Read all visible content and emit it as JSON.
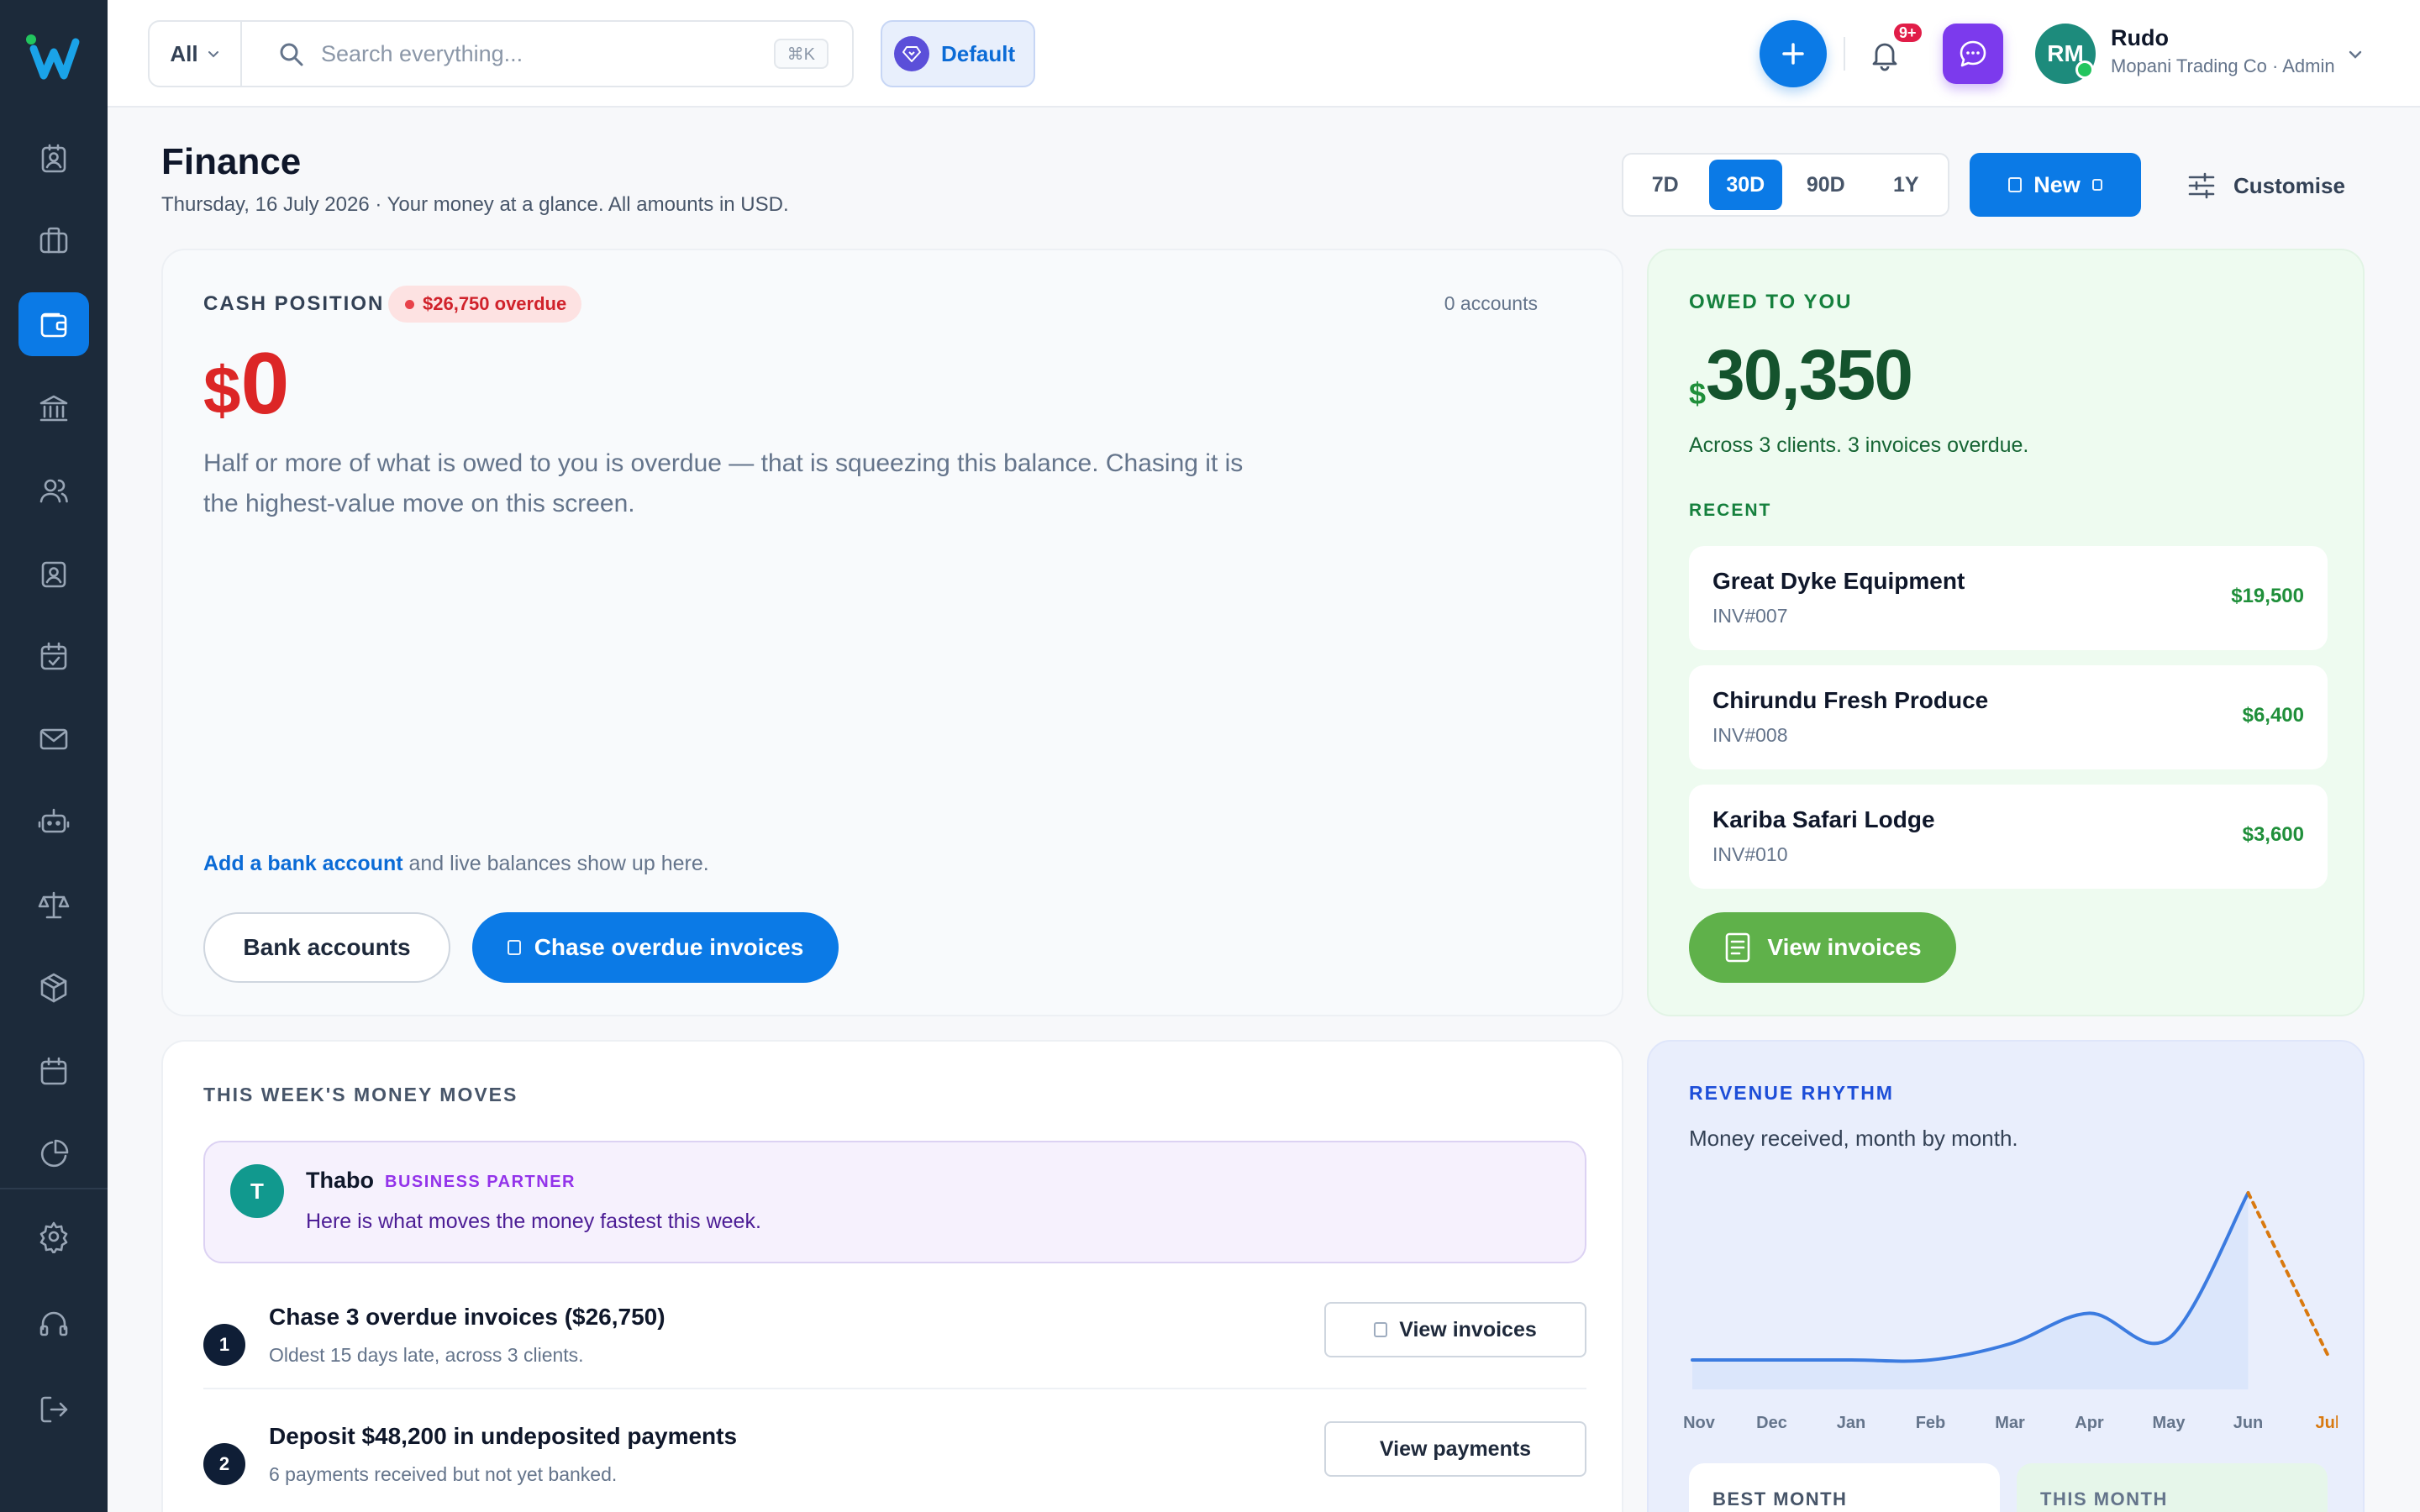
{
  "topbar": {
    "search_scope": "All",
    "search_placeholder": "Search everything...",
    "search_shortcut": "⌘K",
    "workspace": "Default",
    "notification_badge": "9+",
    "user": {
      "initials": "RM",
      "name": "Rudo",
      "org": "Mopani Trading Co · Admin"
    }
  },
  "sidebar": {
    "items": [
      {
        "icon": "contact-card-icon"
      },
      {
        "icon": "briefcase-icon"
      },
      {
        "icon": "wallet-icon",
        "active": true
      },
      {
        "icon": "bank-icon"
      },
      {
        "icon": "users-icon"
      },
      {
        "icon": "id-badge-icon"
      },
      {
        "icon": "calendar-check-icon"
      },
      {
        "icon": "mail-icon"
      },
      {
        "icon": "bot-icon"
      },
      {
        "icon": "scale-icon"
      },
      {
        "icon": "package-icon"
      },
      {
        "icon": "calendar-icon"
      },
      {
        "icon": "pie-chart-icon"
      }
    ],
    "bottom_items": [
      {
        "icon": "settings-icon"
      },
      {
        "icon": "headset-icon"
      },
      {
        "icon": "logout-icon"
      }
    ]
  },
  "header": {
    "title": "Finance",
    "subtitle": "Thursday, 16 July 2026 · Your money at a glance. All amounts in USD.",
    "ranges": [
      "7D",
      "30D",
      "90D",
      "1Y"
    ],
    "active_range": "30D",
    "new_label": "New",
    "customise_label": "Customise"
  },
  "cash": {
    "label": "CASH POSITION",
    "overdue_badge": "$26,750 overdue",
    "accounts": "0 accounts",
    "currency": "$",
    "amount": "0",
    "message": "Half or more of what is owed to you is overdue — that is squeezing this balance. Chasing it is the highest-value move on this screen.",
    "hint_link": "Add a bank account",
    "hint_rest": " and live balances show up here.",
    "btn_bank": "Bank accounts",
    "btn_chase": "Chase overdue invoices"
  },
  "owed": {
    "label": "OWED TO YOU",
    "currency": "$",
    "amount": "30,350",
    "sub": "Across 3 clients. 3 invoices overdue.",
    "recent_label": "RECENT",
    "invoices": [
      {
        "name": "Great Dyke Equipment",
        "id": "INV#007",
        "amount": "$19,500"
      },
      {
        "name": "Chirundu Fresh Produce",
        "id": "INV#008",
        "amount": "$6,400"
      },
      {
        "name": "Kariba Safari Lodge",
        "id": "INV#010",
        "amount": "$3,600"
      }
    ],
    "btn": "View invoices"
  },
  "moves": {
    "label": "THIS WEEK'S MONEY MOVES",
    "partner": {
      "initial": "T",
      "name": "Thabo",
      "role": "BUSINESS PARTNER",
      "message": "Here is what moves the money fastest this week."
    },
    "items": [
      {
        "num": "1",
        "title": "Chase 3 overdue invoices ($26,750)",
        "sub": "Oldest 15 days late, across 3 clients.",
        "btn": "View invoices"
      },
      {
        "num": "2",
        "title": "Deposit $48,200 in undeposited payments",
        "sub": "6 payments received but not yet banked.",
        "btn": "View payments"
      }
    ]
  },
  "revenue": {
    "label": "REVENUE RHYTHM",
    "sub": "Money received, month by month.",
    "best_label": "BEST MONTH",
    "this_label": "THIS MONTH"
  },
  "chart_data": {
    "type": "area",
    "categories": [
      "Nov",
      "Dec",
      "Jan",
      "Feb",
      "Mar",
      "Apr",
      "May",
      "Jun",
      "Jul"
    ],
    "values": [
      0.07,
      0.07,
      0.07,
      0.07,
      0.16,
      0.33,
      0.19,
      1.0,
      0.1
    ],
    "projected_last": true,
    "highlight_category": "Jul",
    "colors": {
      "line": "#3b7be0",
      "fill": "#d9e4fb",
      "projection": "#d9790f"
    }
  },
  "colors": {
    "sidebar": "#1c2a3a",
    "accent": "#0b7ae6",
    "danger": "#dc2626",
    "success": "#1f8f3a"
  }
}
